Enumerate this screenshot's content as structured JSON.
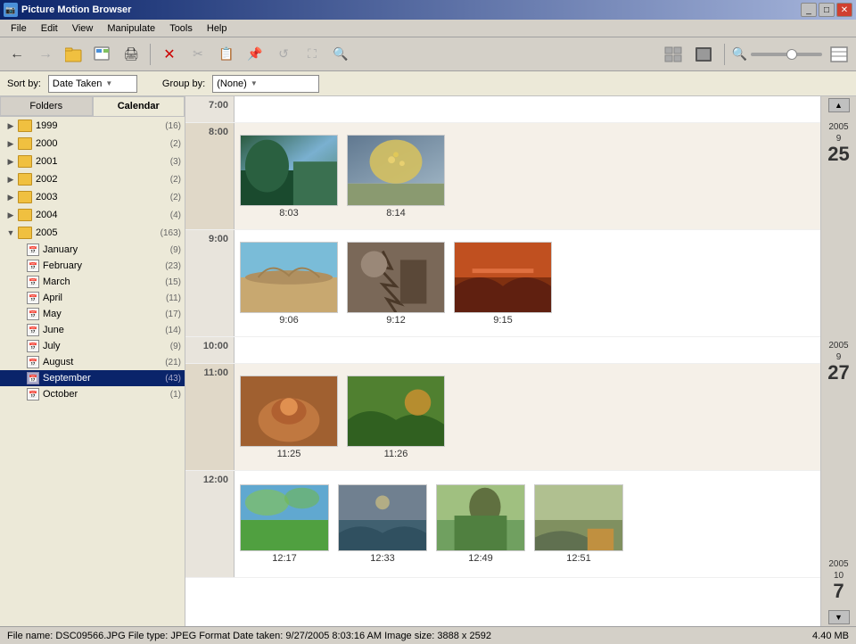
{
  "window": {
    "title": "Picture Motion Browser",
    "controls": [
      "minimize",
      "maximize",
      "close"
    ]
  },
  "menu": {
    "items": [
      "File",
      "Edit",
      "View",
      "Manipulate",
      "Tools",
      "Help"
    ]
  },
  "toolbar": {
    "buttons": [
      "←",
      "→",
      "📁",
      "🖼",
      "🖨",
      "✕",
      "✂",
      "📋",
      "✏",
      "📐",
      "🖥",
      "🔍"
    ],
    "right_buttons": [
      "🖼",
      "🎬",
      "📊"
    ],
    "zoom_label": "Zoom"
  },
  "sort_bar": {
    "sort_label": "Sort by:",
    "sort_value": "Date Taken",
    "group_label": "Group by:",
    "group_value": "(None)"
  },
  "sidebar": {
    "tabs": [
      "Folders",
      "Calendar"
    ],
    "active_tab": "Calendar",
    "tree": [
      {
        "id": "1999",
        "label": "1999",
        "count": "(16)",
        "type": "folder",
        "expanded": false
      },
      {
        "id": "2000",
        "label": "2000",
        "count": "(2)",
        "type": "folder",
        "expanded": false
      },
      {
        "id": "2001",
        "label": "2001",
        "count": "(3)",
        "type": "folder",
        "expanded": false
      },
      {
        "id": "2002",
        "label": "2002",
        "count": "(2)",
        "type": "folder",
        "expanded": false
      },
      {
        "id": "2003",
        "label": "2003",
        "count": "(2)",
        "type": "folder",
        "expanded": false
      },
      {
        "id": "2004",
        "label": "2004",
        "count": "(4)",
        "type": "folder",
        "expanded": false
      },
      {
        "id": "2005",
        "label": "2005",
        "count": "(163)",
        "type": "folder",
        "expanded": true,
        "children": [
          {
            "id": "jan",
            "label": "January",
            "count": "(9)",
            "type": "calendar"
          },
          {
            "id": "feb",
            "label": "February",
            "count": "(23)",
            "type": "calendar"
          },
          {
            "id": "mar",
            "label": "March",
            "count": "(15)",
            "type": "calendar"
          },
          {
            "id": "apr",
            "label": "April",
            "count": "(11)",
            "type": "calendar"
          },
          {
            "id": "may",
            "label": "May",
            "count": "(17)",
            "type": "calendar"
          },
          {
            "id": "jun",
            "label": "June",
            "count": "(14)",
            "type": "calendar"
          },
          {
            "id": "jul",
            "label": "July",
            "count": "(9)",
            "type": "calendar"
          },
          {
            "id": "aug",
            "label": "August",
            "count": "(21)",
            "type": "calendar"
          },
          {
            "id": "sep",
            "label": "September",
            "count": "(43)",
            "type": "calendar",
            "selected": true
          },
          {
            "id": "oct",
            "label": "October",
            "count": "(1)",
            "type": "calendar"
          }
        ]
      }
    ]
  },
  "content": {
    "time_sections": [
      {
        "time": "7:00",
        "photos": []
      },
      {
        "time": "8:00",
        "photos": [
          {
            "timestamp": "8:03",
            "color1": "#4a7a5e",
            "color2": "#7ab0d0"
          },
          {
            "timestamp": "8:14",
            "color1": "#d4c060",
            "color2": "#7090b0"
          }
        ]
      },
      {
        "time": "9:00",
        "photos": [
          {
            "timestamp": "9:06",
            "color1": "#b08040",
            "color2": "#60a0c0"
          },
          {
            "timestamp": "9:12",
            "color1": "#5a4030",
            "color2": "#a09080"
          },
          {
            "timestamp": "9:15",
            "color1": "#c05020",
            "color2": "#b07040"
          }
        ]
      },
      {
        "time": "10:00",
        "photos": []
      },
      {
        "time": "11:00",
        "photos": [
          {
            "timestamp": "11:25",
            "color1": "#b06020",
            "color2": "#d08040"
          },
          {
            "timestamp": "11:26",
            "color1": "#508030",
            "color2": "#a0b070"
          }
        ]
      },
      {
        "time": "12:00",
        "photos": [
          {
            "timestamp": "12:17",
            "color1": "#60a050",
            "color2": "#80c060"
          },
          {
            "timestamp": "12:33",
            "color1": "#4060a0",
            "color2": "#80a0c0"
          },
          {
            "timestamp": "12:49",
            "color1": "#708050",
            "color2": "#a0b870"
          },
          {
            "timestamp": "12:51",
            "color1": "#c08040",
            "color2": "#d0a060"
          }
        ]
      }
    ],
    "date_markers": [
      {
        "year": "2005",
        "month": "9",
        "day": "25"
      },
      {
        "year": "2005",
        "month": "9",
        "day": "27"
      },
      {
        "year": "2005",
        "month": "10",
        "day": "7"
      }
    ]
  },
  "status_bar": {
    "file_info": "File name: DSC09566.JPG  File type: JPEG Format  Date taken: 9/27/2005 8:03:16 AM  Image size: 3888 x 2592",
    "file_size": "4.40 MB"
  },
  "colors": {
    "titlebar_start": "#0a246a",
    "titlebar_end": "#a6b5db",
    "selected_bg": "#0a246a",
    "selected_fg": "white",
    "sidebar_bg": "#ece9d8",
    "toolbar_bg": "#d4d0c8",
    "time_col_bg": "#e8e4dc"
  }
}
